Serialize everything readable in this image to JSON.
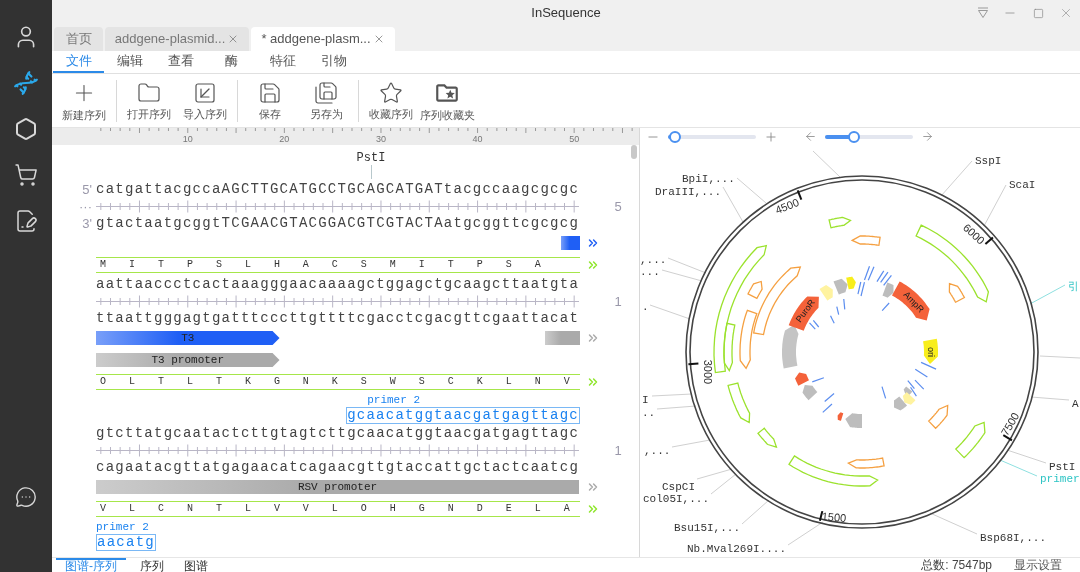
{
  "window": {
    "title": "InSequence"
  },
  "sidebar": {
    "items": [
      {
        "selected": false
      },
      {
        "selected": true
      },
      {
        "selected": false
      },
      {
        "selected": false
      },
      {
        "selected": false
      }
    ],
    "bottom_items": [
      {
        "selected": false
      }
    ]
  },
  "document_tabs": [
    {
      "label": "首页",
      "selected": false,
      "closable": false
    },
    {
      "label": "addgene-plasmid...",
      "selected": false,
      "closable": true
    },
    {
      "label": "* addgene-plasm...",
      "selected": true,
      "closable": true
    }
  ],
  "menu_tabs": [
    {
      "label": "文件",
      "selected": true
    },
    {
      "label": "编辑",
      "selected": false
    },
    {
      "label": "查看",
      "selected": false
    },
    {
      "label": "酶",
      "selected": false
    },
    {
      "label": "特征",
      "selected": false
    },
    {
      "label": "引物",
      "selected": false
    }
  ],
  "toolbar": {
    "groups": [
      [
        {
          "label": "新建序列"
        }
      ],
      [
        {
          "label": "打开序列"
        },
        {
          "label": "导入序列"
        }
      ],
      [
        {
          "label": "保存"
        },
        {
          "label": "另存为"
        }
      ],
      [
        {
          "label": "收藏序列"
        },
        {
          "label": "序列收藏夹"
        }
      ]
    ]
  },
  "sequence_view": {
    "ruler": [
      "10",
      "20",
      "30",
      "40",
      "50"
    ],
    "rows": [
      {
        "kind": "enzyme",
        "label": "PstI"
      },
      {
        "kind": "dna",
        "top": "catgattacgccaAGCTTGCATGCCTGCAGCATGATtacgccaagcgcgc",
        "bottom": "gtactaatgcggtTCGAACGTACGGACGTCGTACTAatgcggttcgcgcg",
        "five": "5'",
        "more": "···",
        "three": "3'",
        "index": "5"
      },
      {
        "kind": "features",
        "bars": [
          {
            "kind": "end",
            "color": "#1f5ff5"
          }
        ]
      },
      {
        "kind": "translation",
        "residues": "M I T P S L H A C S M I T P S A"
      },
      {
        "kind": "dna",
        "top": "aattaaccctcactaaagggaacaaaagctggagctgcaagcttaatgta",
        "bottom": "ttaattgggagtgatttcccttgttttcgacctcgacgttcgaattacat",
        "index": "1"
      },
      {
        "kind": "features",
        "bars": [
          {
            "kind": "head",
            "color": "#1f5ff5",
            "label": "T3"
          },
          {
            "kind": "tail",
            "color": "#aaaaaa"
          }
        ]
      },
      {
        "kind": "features",
        "bars": [
          {
            "kind": "head",
            "color": "#aaaaaa",
            "label": "T3 promoter"
          }
        ]
      },
      {
        "kind": "translation",
        "residues": "O L T L T K G N K S W S C K L N V"
      },
      {
        "kind": "primers",
        "sites": [
          {
            "kind": "tail",
            "label": "primer 2",
            "sequence": "gcaacatggtaacgatgagttagc"
          }
        ]
      },
      {
        "kind": "dna",
        "top": "gtcttatgcaatactcttgtagtcttgcaacatggtaacgatgagttagc",
        "bottom": "cagaatacgttatgagaacatcagaacgttgtaccattgctactcaatcg",
        "index": "1"
      },
      {
        "kind": "features",
        "bars": [
          {
            "kind": "full",
            "color": "#aaaaaa",
            "label": "RSV promoter"
          }
        ]
      },
      {
        "kind": "translation",
        "residues": "V L C N T L V V L O H G N D E L A"
      },
      {
        "kind": "primers",
        "sites": [
          {
            "kind": "head",
            "label": "primer 2",
            "sequence": "aacatg"
          }
        ]
      }
    ]
  },
  "map_view": {
    "zoom_slider": {
      "level": 0.08
    },
    "rotation_slider": {
      "level": 0.33
    },
    "ticks": [
      "4500",
      "6000",
      "7500",
      "1500",
      "3000"
    ],
    "features": [
      {
        "label": "AmpR",
        "color": "#f4623a"
      },
      {
        "label": "PuroR",
        "color": "#f4623a"
      },
      {
        "label": "ori",
        "color": "#f8ee1c"
      }
    ],
    "labels": [
      {
        "text": "SspI",
        "kind": "enzyme"
      },
      {
        "text": "BpiI,...",
        "kind": "enzyme"
      },
      {
        "text": "ScaI",
        "kind": "enzyme"
      },
      {
        "text": "DraIII,...",
        "kind": "enzyme"
      },
      {
        "text": ",...",
        "kind": "enzyme"
      },
      {
        "text": "...",
        "kind": "enzyme"
      },
      {
        "text": "引",
        "kind": "primer"
      },
      {
        "text": ".",
        "kind": "enzyme"
      },
      {
        "text": "I",
        "kind": "enzyme"
      },
      {
        "text": "A",
        "kind": "enzyme"
      },
      {
        "text": "..",
        "kind": "enzyme"
      },
      {
        "text": ",...",
        "kind": "enzyme"
      },
      {
        "text": "PstI",
        "kind": "enzyme"
      },
      {
        "text": "primer",
        "kind": "primer"
      },
      {
        "text": "CspCI",
        "kind": "enzyme"
      },
      {
        "text": "col05I,...",
        "kind": "enzyme"
      },
      {
        "text": "Bsu15I,...",
        "kind": "enzyme"
      },
      {
        "text": "Bsp68I,...",
        "kind": "enzyme"
      },
      {
        "text": "Nb.Mval269I....",
        "kind": "enzyme"
      }
    ]
  },
  "bottom_tabs": [
    {
      "label": "图谱-序列",
      "selected": true
    },
    {
      "label": "序列",
      "selected": false
    },
    {
      "label": "图谱",
      "selected": false
    }
  ],
  "status": {
    "total": "总数: 7547bp",
    "settings": "显示设置"
  }
}
